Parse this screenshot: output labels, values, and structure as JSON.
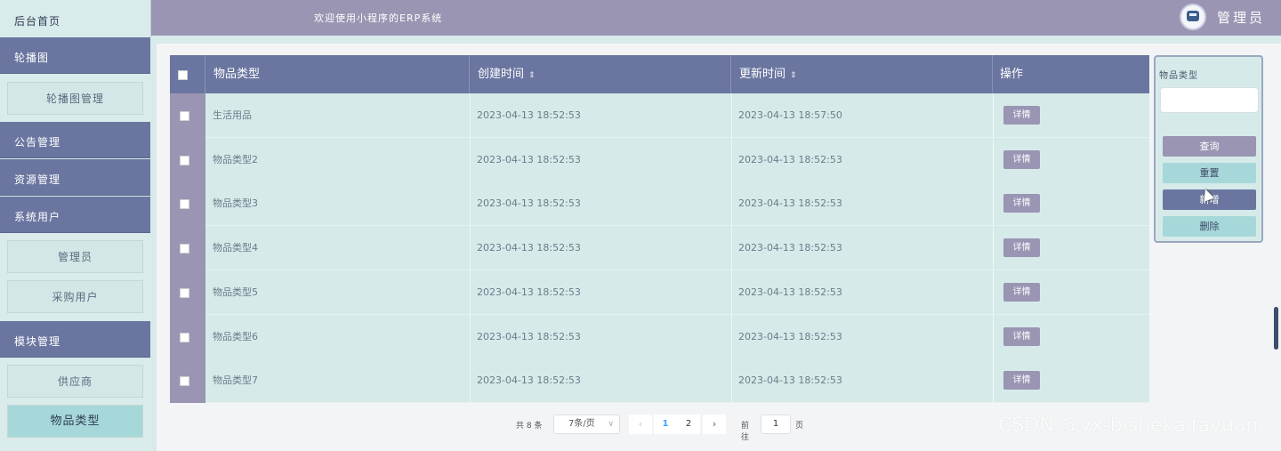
{
  "header": {
    "welcome": "欢迎使用小程序的ERP系统",
    "user": "管理员"
  },
  "sidebar": {
    "home": "后台首页",
    "groups": [
      {
        "label": "轮播图",
        "items": [
          "轮播图管理"
        ]
      },
      {
        "label": "公告管理",
        "items": []
      },
      {
        "label": "资源管理",
        "items": []
      },
      {
        "label": "系统用户",
        "items": [
          "管理员",
          "采购用户"
        ]
      },
      {
        "label": "模块管理",
        "items": [
          "供应商",
          "物品类型"
        ]
      }
    ]
  },
  "table": {
    "headers": [
      "物品类型",
      "创建时间",
      "更新时间",
      "操作"
    ],
    "rows": [
      {
        "type": "生活用品",
        "created": "2023-04-13 18:52:53",
        "updated": "2023-04-13 18:57:50",
        "action": "详情"
      },
      {
        "type": "物品类型2",
        "created": "2023-04-13 18:52:53",
        "updated": "2023-04-13 18:52:53",
        "action": "详情"
      },
      {
        "type": "物品类型3",
        "created": "2023-04-13 18:52:53",
        "updated": "2023-04-13 18:52:53",
        "action": "详情"
      },
      {
        "type": "物品类型4",
        "created": "2023-04-13 18:52:53",
        "updated": "2023-04-13 18:52:53",
        "action": "详情"
      },
      {
        "type": "物品类型5",
        "created": "2023-04-13 18:52:53",
        "updated": "2023-04-13 18:52:53",
        "action": "详情"
      },
      {
        "type": "物品类型6",
        "created": "2023-04-13 18:52:53",
        "updated": "2023-04-13 18:52:53",
        "action": "详情"
      },
      {
        "type": "物品类型7",
        "created": "2023-04-13 18:52:53",
        "updated": "2023-04-13 18:52:53",
        "action": "详情"
      }
    ]
  },
  "search_panel": {
    "label": "物品类型",
    "input_value": "",
    "buttons": {
      "query": "查询",
      "reset": "重置",
      "add": "新增",
      "delete": "删除"
    }
  },
  "pagination": {
    "total": "共 8 条",
    "page_size": "7条/页",
    "pages": [
      "1",
      "2"
    ],
    "current_page": "1",
    "goto_label": "前往",
    "goto_value": "1",
    "goto_unit": "页"
  },
  "watermark": "CSDN @vx-bishekaifayuan",
  "colors": {
    "header": "#9a95b3",
    "sidebar_category": "#6a76a0",
    "table_row": "#d6ebe9",
    "active_sub": "#a6d7d9"
  }
}
